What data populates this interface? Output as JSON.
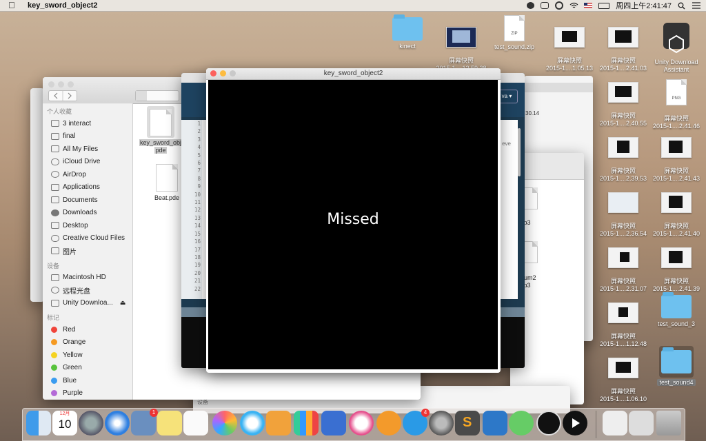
{
  "menubar": {
    "app_name": "key_sword_object2",
    "clock": "周四上午2:41:47"
  },
  "desktop_icons": [
    {
      "label": "kinect",
      "kind": "folder"
    },
    {
      "label": "屏幕快照\n2015-1....12.59.38",
      "kind": "shot"
    },
    {
      "label": "test_sound.zip",
      "kind": "zip"
    },
    {
      "label": "屏幕快照\n2015-1....1.05.13",
      "kind": "shot"
    },
    {
      "label": "屏幕快照\n2015-1....2.41.03",
      "kind": "shot"
    },
    {
      "label": "Unity Download\nAssistant",
      "kind": "app"
    },
    {
      "label": "屏幕快照\n2015-1....2.40.55",
      "kind": "shot"
    },
    {
      "label": "屏幕快照\n2015-1....2.41.46",
      "kind": "png"
    },
    {
      "label": "屏幕快照\n2015-1....2.39.53",
      "kind": "shot"
    },
    {
      "label": "屏幕快照\n2015-1....2.41.43",
      "kind": "shot"
    },
    {
      "label": "屏幕快照\n2015-1....2.36.54",
      "kind": "shot"
    },
    {
      "label": "屏幕快照\n2015-1....2.41.40",
      "kind": "shot"
    },
    {
      "label": "屏幕快照\n2015-1....2.31.07",
      "kind": "shot"
    },
    {
      "label": "屏幕快照\n2015-1....2.41.39",
      "kind": "shot"
    },
    {
      "label": "屏幕快照\n2015-1....1.12.48",
      "kind": "shot"
    },
    {
      "label": "test_sound_3",
      "kind": "folder"
    },
    {
      "label": "屏幕快照\n2015-1....1.06.10",
      "kind": "shot"
    },
    {
      "label": "test_sound4",
      "kind": "folder"
    }
  ],
  "finder": {
    "section_favorites": "个人收藏",
    "favorites": [
      "3 interact",
      "final",
      "All My Files",
      "iCloud Drive",
      "AirDrop",
      "Applications",
      "Documents",
      "Downloads",
      "Desktop",
      "Creative Cloud Files",
      "图片"
    ],
    "section_devices": "设备",
    "devices": [
      "Macintosh HD",
      "远程光盘",
      "Unity Downloa..."
    ],
    "section_tags": "标记",
    "tags": [
      {
        "label": "Red",
        "color": "#f0443a"
      },
      {
        "label": "Orange",
        "color": "#f59a22"
      },
      {
        "label": "Yellow",
        "color": "#f5d322"
      },
      {
        "label": "Green",
        "color": "#58c33c"
      },
      {
        "label": "Blue",
        "color": "#3a9cf0"
      },
      {
        "label": "Purple",
        "color": "#b46ad7"
      }
    ],
    "files": [
      {
        "name": "key_sword_object2.pde",
        "line1": "key_sword_obj",
        "line2": "pde"
      },
      {
        "name": "Beat.pde",
        "line1": "Beat.pde",
        "line2": ""
      }
    ]
  },
  "editor": {
    "line_numbers": [
      "1",
      "2",
      "3",
      "4",
      "5",
      "6",
      "7",
      "8",
      "9",
      "10",
      "11",
      "12",
      "13",
      "14",
      "15",
      "16",
      "17",
      "18",
      "19",
      "20",
      "21",
      "22"
    ],
    "mode_label": "va ▾",
    "peek_text": "eve"
  },
  "back_finder": {
    "files": [
      "mp3",
      "drum2\nmp3",
      "ound"
    ],
    "date_fragment": "30.14",
    "device_label": "设备"
  },
  "sketch": {
    "title": "key_sword_object2",
    "message": "Missed"
  },
  "dock": {
    "calendar_month": "12月",
    "calendar_day": "10",
    "badge_preview": "1",
    "badge_appstore": "4",
    "items": [
      "Finder",
      "Calendar",
      "Launchpad",
      "Safari",
      "Preview",
      "Notes",
      "Reminders",
      "Photos",
      "Messages",
      "Pages",
      "Numbers",
      "Keynote",
      "iTunes",
      "iBooks",
      "App Store",
      "System Preferences",
      "Sublime Text",
      "Migration",
      "WeChat",
      "Unity",
      "QuickTime",
      "Documents",
      "Downloads",
      "Trash"
    ]
  }
}
